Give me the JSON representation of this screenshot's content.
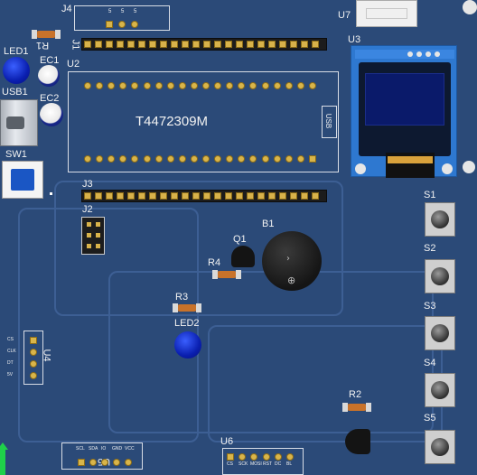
{
  "labels": {
    "j4": "J4",
    "j4_pins": [
      "5",
      "5",
      "5"
    ],
    "u7": "U7",
    "j1": "J1",
    "u3": "U3",
    "r1": "R1",
    "led1": "LED1",
    "ec1": "EC1",
    "u2": "U2",
    "usb1": "USB1",
    "ec2": "EC2",
    "chip_text": "T4472309M",
    "usb_text": "USB",
    "sw1": "SW1",
    "j3": "J3",
    "j2": "J2",
    "q1": "Q1",
    "b1": "B1",
    "r4": "R4",
    "r3": "R3",
    "led2": "LED2",
    "u4": "U4",
    "u4_pins": [
      "CS",
      "CLK",
      "DT",
      "5V"
    ],
    "s1": "S1",
    "s2": "S2",
    "s3": "S3",
    "s4": "S4",
    "s5": "S5",
    "r2": "R2",
    "u6": "U6",
    "u5": "U5",
    "u5_pins": [
      "SCL",
      "SDA",
      "IO",
      "GND",
      "VCC"
    ],
    "u6_pins": [
      "CS",
      "SCK",
      "MOSI",
      "RST",
      "DC",
      "BL"
    ]
  },
  "colors": {
    "board": "#2b4a78",
    "silkscreen": "#f2f2f2",
    "pad": "#d9b54a",
    "oled_screen": "#0a1a6a",
    "oled_pcb": "#2e78d0",
    "led": "#0a1fb0",
    "resistor": "#c8722a"
  }
}
